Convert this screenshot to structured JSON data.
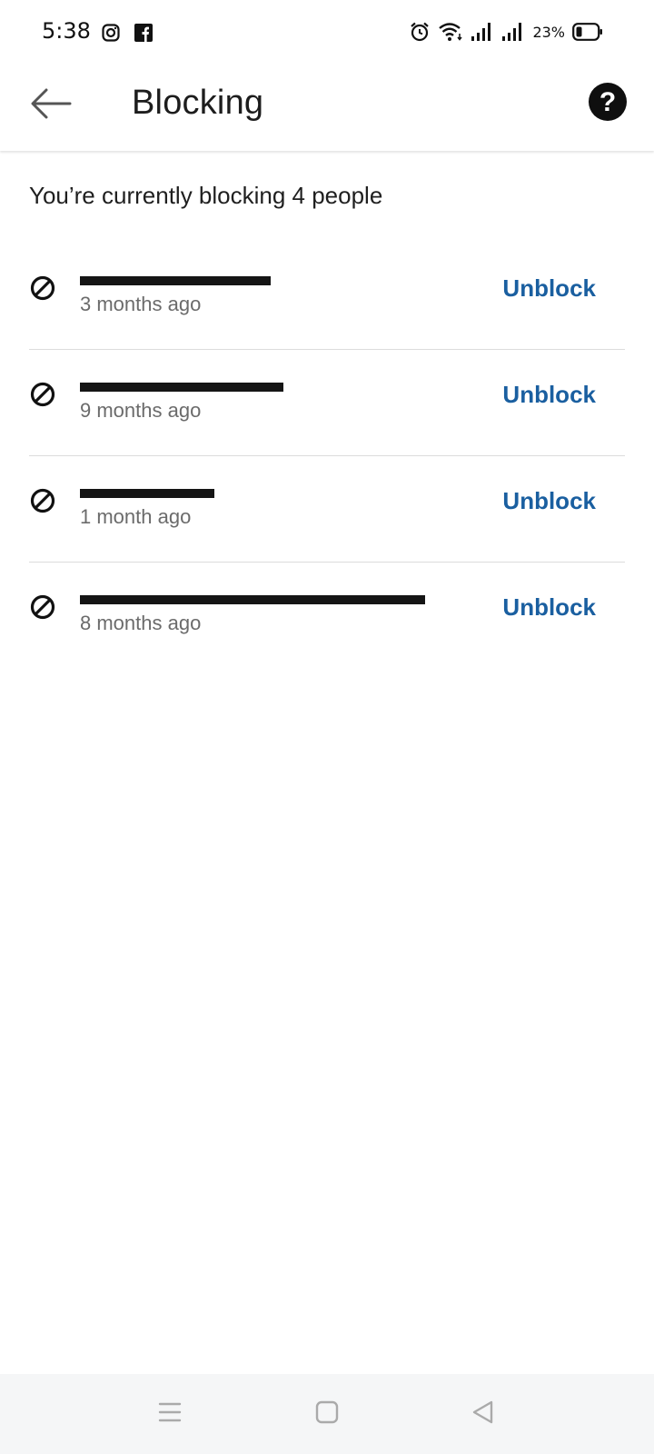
{
  "status_bar": {
    "time": "5:38",
    "battery": "23%",
    "icons": [
      "instagram-icon",
      "facebook-icon",
      "alarm-icon",
      "wifi-icon",
      "signal-icon",
      "signal-icon",
      "battery-icon"
    ]
  },
  "header": {
    "title": "Blocking",
    "back_icon": "arrow-left-icon",
    "help_icon": "help-circle-icon",
    "help_glyph": "?"
  },
  "summary": "You’re currently blocking 4 people",
  "blocked_users": [
    {
      "time": "3 months ago",
      "action": "Unblock"
    },
    {
      "time": "9 months ago",
      "action": "Unblock"
    },
    {
      "time": "1 month ago",
      "action": "Unblock"
    },
    {
      "time": "8 months ago",
      "action": "Unblock"
    }
  ],
  "nav_bar": {
    "items": [
      "menu-icon",
      "home-square-icon",
      "back-triangle-icon"
    ]
  },
  "colors": {
    "accent": "#1a5fa0",
    "text": "#1f1f1f",
    "secondary_text": "#6b6b6b",
    "divider": "#dcdcdc"
  }
}
